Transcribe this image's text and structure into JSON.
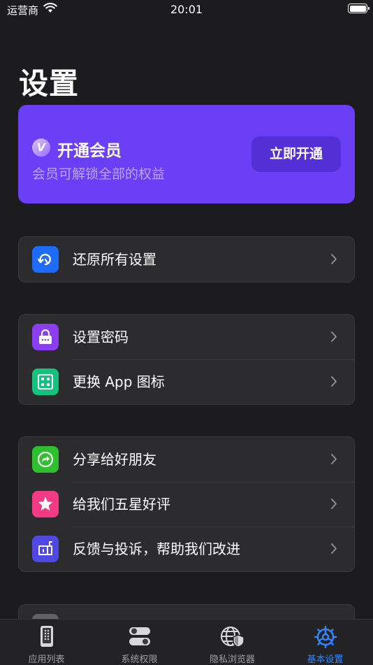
{
  "status_bar": {
    "carrier": "运营商",
    "time": "20:01"
  },
  "page_title": "设置",
  "vip": {
    "badge": "V",
    "title": "开通会员",
    "subtitle": "会员可解锁全部的权益",
    "button": "立即开通",
    "color": "#6b3ff5"
  },
  "groups": [
    {
      "items": [
        {
          "label": "还原所有设置",
          "icon": "restore-icon",
          "icon_bg": "#1e6cff"
        }
      ]
    },
    {
      "items": [
        {
          "label": "设置密码",
          "icon": "lock-icon",
          "icon_bg": "#8b3df0"
        },
        {
          "label": "更换 App 图标",
          "icon": "grid-icon",
          "icon_bg": "#14c27d"
        }
      ]
    },
    {
      "items": [
        {
          "label": "分享给好朋友",
          "icon": "share-icon",
          "icon_bg": "#2dc22d"
        },
        {
          "label": "给我们五星好评",
          "icon": "star-icon",
          "icon_bg": "#f53a85"
        },
        {
          "label": "反馈与投诉，帮助我们改进",
          "icon": "feedback-icon",
          "icon_bg": "#5048e5"
        }
      ]
    }
  ],
  "tabs": [
    {
      "label": "应用列表",
      "icon": "phone-icon"
    },
    {
      "label": "系统权限",
      "icon": "toggle-icon"
    },
    {
      "label": "隐私浏览器",
      "icon": "globe-shield-icon"
    },
    {
      "label": "基本设置",
      "icon": "settings-gear-icon",
      "active": true
    }
  ],
  "accent_color": "#2f88ff"
}
